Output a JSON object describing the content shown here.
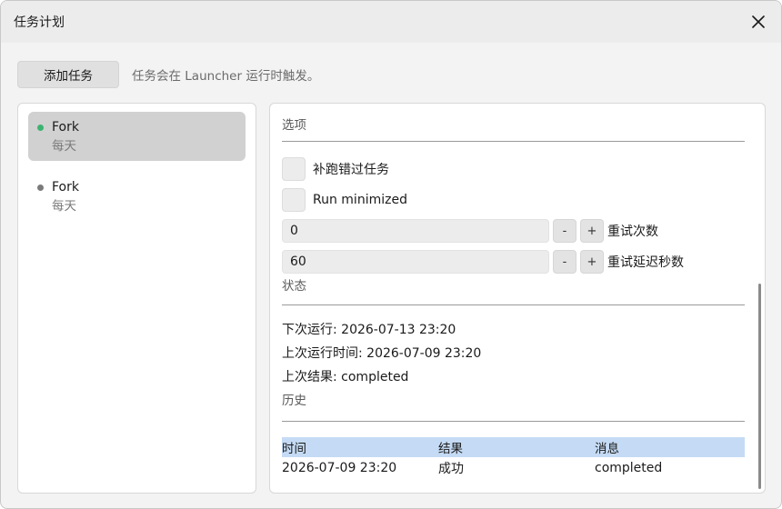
{
  "window": {
    "title": "任务计划",
    "close_icon": "close-icon"
  },
  "toolbar": {
    "add_label": "添加任务",
    "hint": "任务会在 Launcher 运行时触发。"
  },
  "tasks": [
    {
      "name": "Fork",
      "schedule": "每天",
      "status_color": "#3cb371"
    },
    {
      "name": "Fork",
      "schedule": "每天",
      "status_color": "#7a7a7a"
    }
  ],
  "options": {
    "section_title": "选项",
    "catch_up_label": "补跑错过任务",
    "run_minimized_label": "Run minimized",
    "retry_count": {
      "value": "0",
      "label": "重试次数",
      "minus": "-",
      "plus": "+"
    },
    "retry_delay": {
      "value": "60",
      "label": "重试延迟秒数",
      "minus": "-",
      "plus": "+"
    }
  },
  "status": {
    "section_title": "状态",
    "next_run": "下次运行: 2026-07-13 23:20",
    "last_run": "上次运行时间: 2026-07-09 23:20",
    "last_result": "上次结果: completed"
  },
  "history": {
    "section_title": "历史",
    "columns": [
      "时间",
      "结果",
      "消息"
    ],
    "rows": [
      [
        "2026-07-09 23:20",
        "成功",
        "completed"
      ]
    ]
  },
  "colors": {
    "header_bg": "#c5dbf5",
    "selected_bg": "#d1d1d1"
  }
}
